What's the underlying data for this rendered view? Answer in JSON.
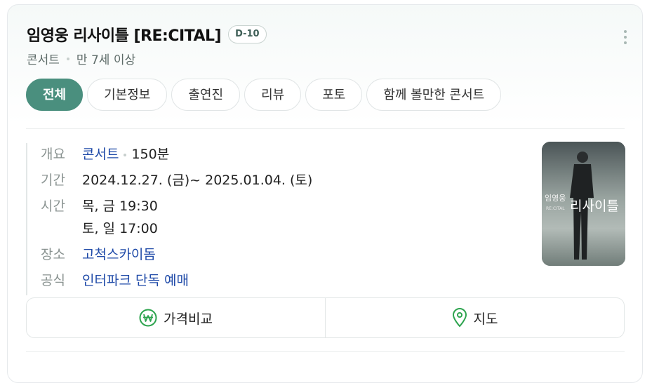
{
  "header": {
    "title": "임영웅 리사이틀 [RE:CITAL]",
    "dday": "D-10",
    "category": "콘서트",
    "age": "만 7세 이상"
  },
  "tabs": [
    {
      "label": "전체",
      "active": true
    },
    {
      "label": "기본정보",
      "active": false
    },
    {
      "label": "출연진",
      "active": false
    },
    {
      "label": "리뷰",
      "active": false
    },
    {
      "label": "포토",
      "active": false
    },
    {
      "label": "함께 볼만한 콘서트",
      "active": false
    }
  ],
  "info": {
    "overview_label": "개요",
    "genre": "콘서트",
    "runtime": "150분",
    "period_label": "기간",
    "period": "2024.12.27. (금)~ 2025.01.04. (토)",
    "time_label": "시간",
    "time1": "목, 금 19:30",
    "time2": "토, 일 17:00",
    "venue_label": "장소",
    "venue": "고척스카이돔",
    "official_label": "공식",
    "official": "인터파크 단독 예매"
  },
  "poster": {
    "title_main": "임영웅",
    "title_big": "리사이틀",
    "title_en": "RE:CITAL"
  },
  "actions": {
    "price": "가격비교",
    "map": "지도"
  },
  "colors": {
    "accent": "#4a8f7e",
    "link": "#1f4aa8"
  }
}
